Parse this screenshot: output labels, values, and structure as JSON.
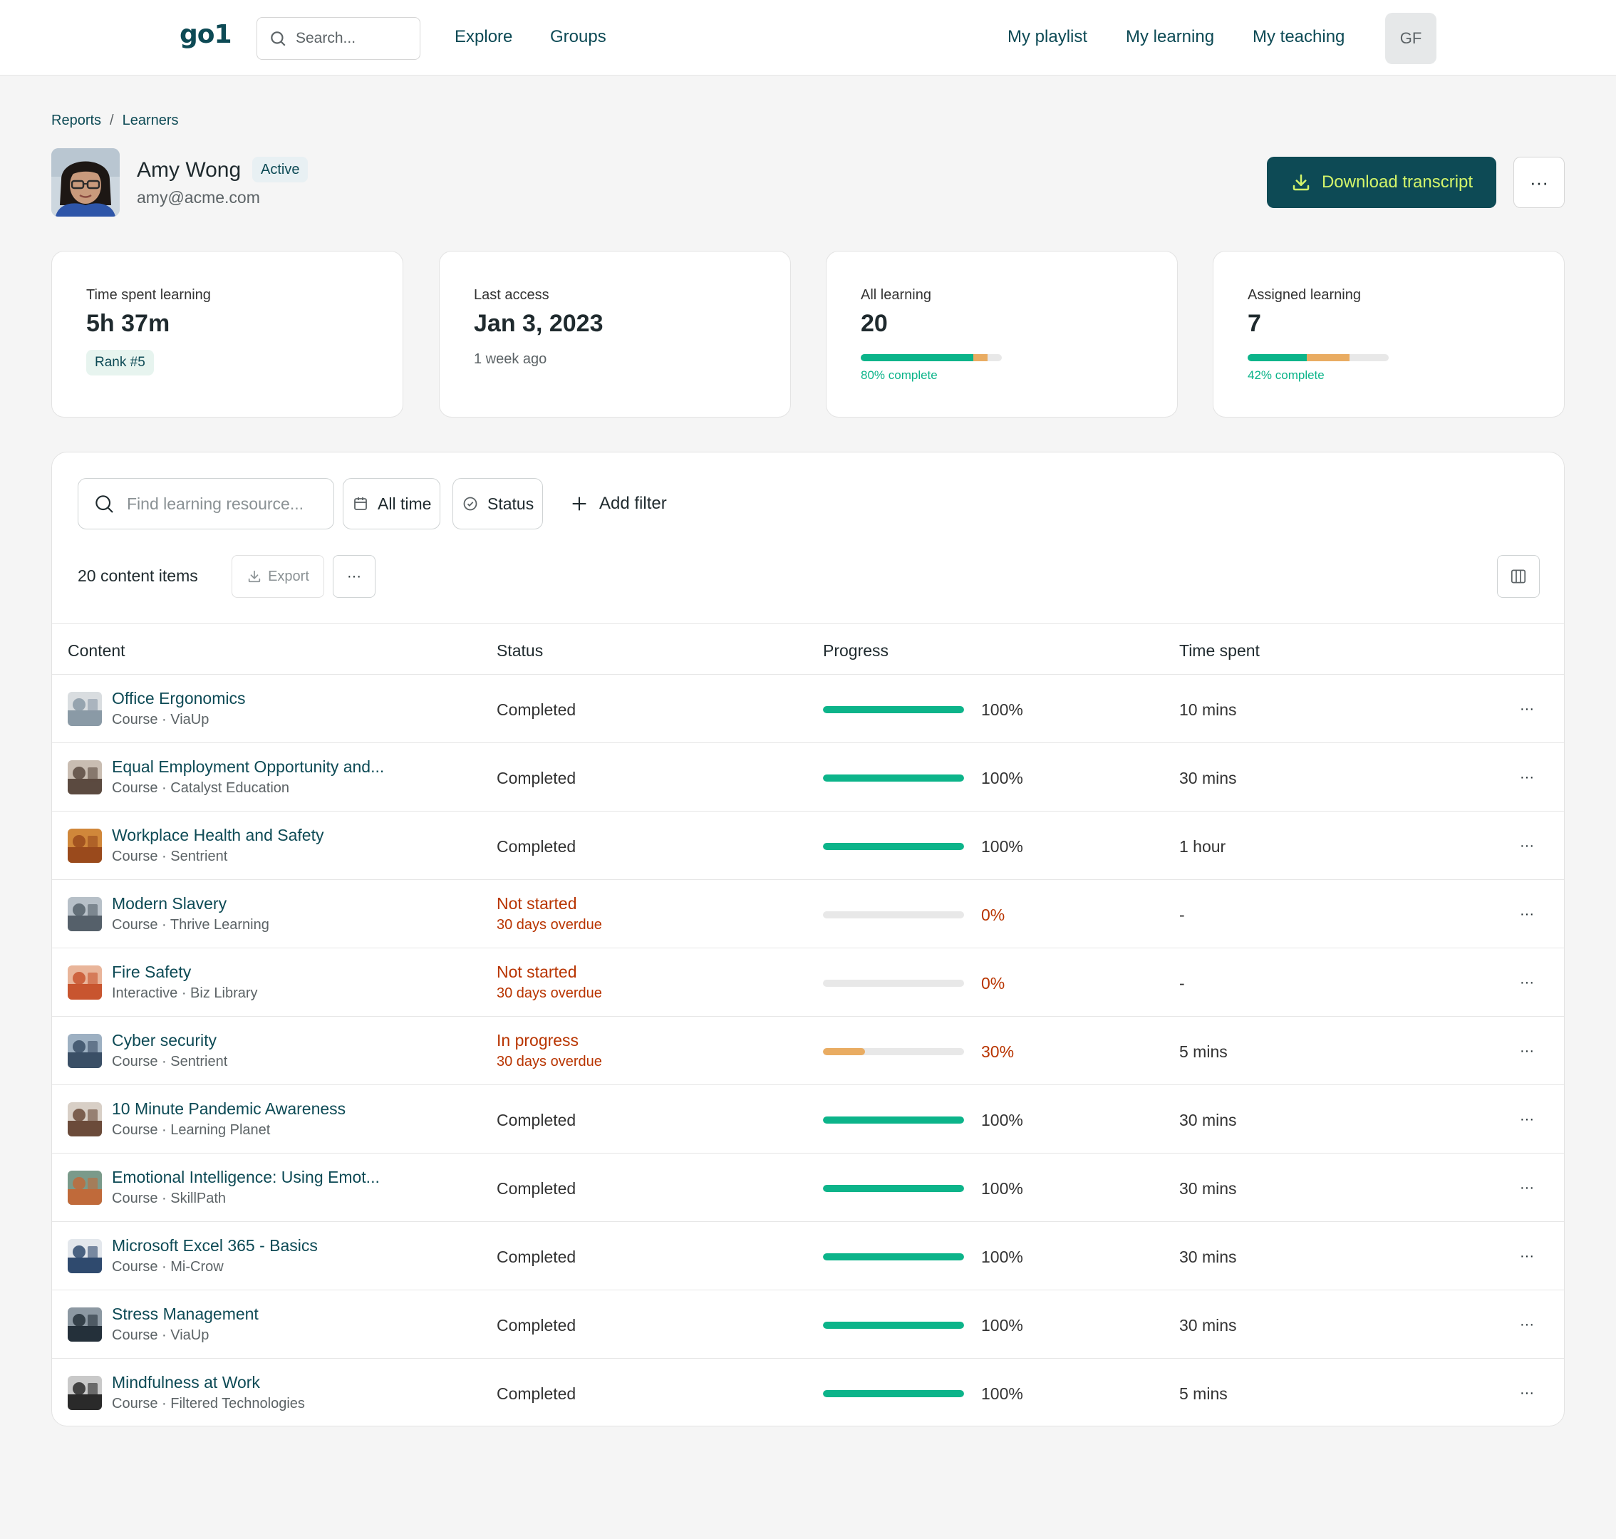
{
  "nav": {
    "logo": "go1",
    "search_placeholder": "Search...",
    "links_left": [
      "Explore",
      "Groups"
    ],
    "links_right": [
      "My playlist",
      "My learning",
      "My teaching"
    ],
    "avatar_initials": "GF"
  },
  "breadcrumb": {
    "items": [
      "Reports",
      "Learners"
    ],
    "separator": "/"
  },
  "profile": {
    "name": "Amy Wong",
    "status": "Active",
    "email": "amy@acme.com"
  },
  "actions": {
    "download_label": "Download transcript",
    "more_label": "···"
  },
  "stats": {
    "time": {
      "label": "Time spent learning",
      "value": "5h 37m",
      "rank": "Rank #5"
    },
    "access": {
      "label": "Last access",
      "value": "Jan 3, 2023",
      "sub": "1 week ago"
    },
    "all": {
      "label": "All learning",
      "value": "20",
      "complete_fraction": 0.8,
      "in_progress_fraction": 0.1,
      "pct_label": "80% complete"
    },
    "assigned": {
      "label": "Assigned learning",
      "value": "7",
      "complete_fraction": 0.42,
      "in_progress_fraction": 0.3,
      "pct_label": "42% complete"
    }
  },
  "filters": {
    "search_placeholder": "Find learning resource...",
    "time_label": "All time",
    "status_label": "Status",
    "add_filter_label": "Add filter"
  },
  "toolbar": {
    "count_label": "20 content items",
    "export_label": "Export",
    "more_label": "···"
  },
  "table": {
    "headers": [
      "Content",
      "Status",
      "Progress",
      "Time spent"
    ],
    "colors": {
      "complete": "#0cb48a",
      "in_progress": "#e9ac62",
      "alert": "#b83400"
    },
    "rows": [
      {
        "title": "Office Ergonomics",
        "meta": "Course · ViaUp",
        "status": "Completed",
        "status_sub": "",
        "progress": 100,
        "progress_label": "100%",
        "time": "10 mins",
        "thumb": [
          "#8a9aa6",
          "#d9dde0"
        ]
      },
      {
        "title": "Equal Employment Opportunity and...",
        "meta": "Course · Catalyst Education",
        "status": "Completed",
        "status_sub": "",
        "progress": 100,
        "progress_label": "100%",
        "time": "30 mins",
        "thumb": [
          "#5b4a40",
          "#c9bdb2"
        ]
      },
      {
        "title": "Workplace Health and Safety",
        "meta": "Course · Sentrient",
        "status": "Completed",
        "status_sub": "",
        "progress": 100,
        "progress_label": "100%",
        "time": "1 hour",
        "thumb": [
          "#9a4a1c",
          "#d0873a"
        ]
      },
      {
        "title": "Modern Slavery",
        "meta": "Course · Thrive Learning",
        "status": "Not started",
        "status_sub": "30 days overdue",
        "progress": 0,
        "progress_label": "0%",
        "time": "-",
        "thumb": [
          "#55606a",
          "#b7c0c8"
        ]
      },
      {
        "title": "Fire Safety",
        "meta": "Interactive · Biz Library",
        "status": "Not started",
        "status_sub": "30 days overdue",
        "progress": 0,
        "progress_label": "0%",
        "time": "-",
        "thumb": [
          "#c8552f",
          "#e9b59a"
        ]
      },
      {
        "title": "Cyber security",
        "meta": "Course · Sentrient",
        "status": "In progress",
        "status_sub": "30 days overdue",
        "progress": 30,
        "progress_label": "30%",
        "time": "5 mins",
        "thumb": [
          "#3a4f66",
          "#9db0c2"
        ]
      },
      {
        "title": "10 Minute Pandemic Awareness",
        "meta": "Course · Learning Planet",
        "status": "Completed",
        "status_sub": "",
        "progress": 100,
        "progress_label": "100%",
        "time": "30 mins",
        "thumb": [
          "#6b4b3a",
          "#d8cfc6"
        ]
      },
      {
        "title": "Emotional Intelligence: Using Emot...",
        "meta": "Course · SkillPath",
        "status": "Completed",
        "status_sub": "",
        "progress": 100,
        "progress_label": "100%",
        "time": "30 mins",
        "thumb": [
          "#c06a3a",
          "#7a9a8a"
        ]
      },
      {
        "title": "Microsoft Excel 365 - Basics",
        "meta": "Course · Mi-Crow",
        "status": "Completed",
        "status_sub": "",
        "progress": 100,
        "progress_label": "100%",
        "time": "30 mins",
        "thumb": [
          "#2f4a6e",
          "#e3e7ec"
        ]
      },
      {
        "title": "Stress Management",
        "meta": "Course · ViaUp",
        "status": "Completed",
        "status_sub": "",
        "progress": 100,
        "progress_label": "100%",
        "time": "30 mins",
        "thumb": [
          "#24303a",
          "#8c98a2"
        ]
      },
      {
        "title": "Mindfulness at Work",
        "meta": "Course · Filtered Technologies",
        "status": "Completed",
        "status_sub": "",
        "progress": 100,
        "progress_label": "100%",
        "time": "5 mins",
        "thumb": [
          "#2a2a2a",
          "#c9c9c9"
        ]
      }
    ]
  }
}
